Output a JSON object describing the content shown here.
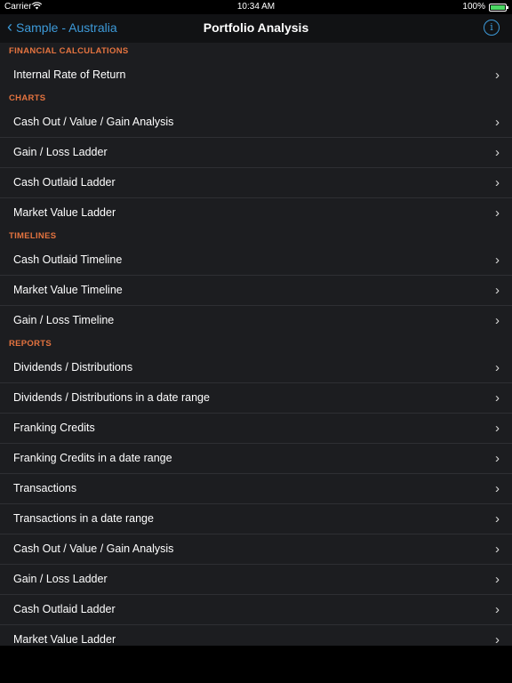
{
  "status_bar": {
    "carrier": "Carrier",
    "time": "10:34 AM",
    "battery": "100%"
  },
  "nav": {
    "back_label": "Sample - Australia",
    "title": "Portfolio Analysis",
    "info_icon": "info-circle-icon"
  },
  "colors": {
    "accent": "#3d9ad9",
    "section_header": "#e4733f",
    "background": "#1c1d20"
  },
  "sections": [
    {
      "header": "FINANCIAL CALCULATIONS",
      "items": [
        "Internal Rate of Return"
      ]
    },
    {
      "header": "CHARTS",
      "items": [
        "Cash Out / Value / Gain Analysis",
        "Gain / Loss Ladder",
        "Cash Outlaid Ladder",
        "Market Value Ladder"
      ]
    },
    {
      "header": "TIMELINES",
      "items": [
        "Cash Outlaid Timeline",
        "Market Value Timeline",
        "Gain / Loss Timeline"
      ]
    },
    {
      "header": "REPORTS",
      "items": [
        "Dividends / Distributions",
        "Dividends / Distributions in a date range",
        "Franking Credits",
        "Franking Credits in a date range",
        "Transactions",
        "Transactions in a date range",
        "Cash Out / Value / Gain Analysis",
        "Gain / Loss Ladder",
        "Cash Outlaid Ladder",
        "Market Value Ladder"
      ]
    }
  ]
}
